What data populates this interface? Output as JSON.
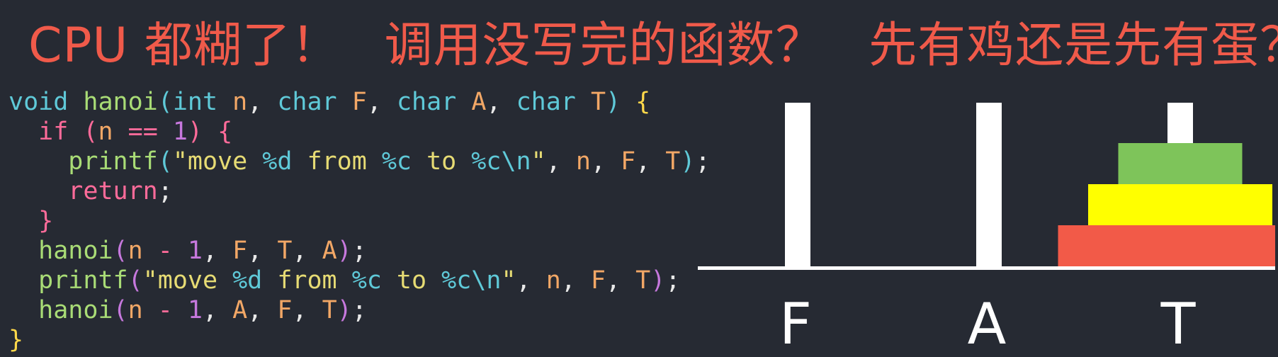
{
  "title": {
    "part1": "CPU 都糊了！",
    "part2": "调用没写完的函数？",
    "part3": "先有鸡还是先有蛋？"
  },
  "code_lines": [
    [
      {
        "t": "void",
        "c": "t-kw"
      },
      {
        "t": " ",
        "c": "t-punc"
      },
      {
        "t": "hanoi",
        "c": "t-fn"
      },
      {
        "t": "(",
        "c": "t-kw"
      },
      {
        "t": "int",
        "c": "t-kw"
      },
      {
        "t": " ",
        "c": "t-punc"
      },
      {
        "t": "n",
        "c": "t-var"
      },
      {
        "t": ", ",
        "c": "t-punc"
      },
      {
        "t": "char",
        "c": "t-kw"
      },
      {
        "t": " ",
        "c": "t-punc"
      },
      {
        "t": "F",
        "c": "t-var"
      },
      {
        "t": ", ",
        "c": "t-punc"
      },
      {
        "t": "char",
        "c": "t-kw"
      },
      {
        "t": " ",
        "c": "t-punc"
      },
      {
        "t": "A",
        "c": "t-var"
      },
      {
        "t": ", ",
        "c": "t-punc"
      },
      {
        "t": "char",
        "c": "t-kw"
      },
      {
        "t": " ",
        "c": "t-punc"
      },
      {
        "t": "T",
        "c": "t-var"
      },
      {
        "t": ")",
        "c": "t-kw"
      },
      {
        "t": " ",
        "c": "t-punc"
      },
      {
        "t": "{",
        "c": "t-brace"
      }
    ],
    [
      {
        "t": "  ",
        "c": "t-punc"
      },
      {
        "t": "if",
        "c": "t-ctrl"
      },
      {
        "t": " ",
        "c": "t-punc"
      },
      {
        "t": "(",
        "c": "t-ctrl"
      },
      {
        "t": "n",
        "c": "t-var"
      },
      {
        "t": " == ",
        "c": "t-op"
      },
      {
        "t": "1",
        "c": "t-num"
      },
      {
        "t": ")",
        "c": "t-ctrl"
      },
      {
        "t": " ",
        "c": "t-punc"
      },
      {
        "t": "{",
        "c": "t-ctrl"
      }
    ],
    [
      {
        "t": "    ",
        "c": "t-punc"
      },
      {
        "t": "printf",
        "c": "t-fn"
      },
      {
        "t": "(",
        "c": "t-kw"
      },
      {
        "t": "\"move ",
        "c": "t-str"
      },
      {
        "t": "%d",
        "c": "t-fmt"
      },
      {
        "t": " from ",
        "c": "t-str"
      },
      {
        "t": "%c",
        "c": "t-fmt"
      },
      {
        "t": " to ",
        "c": "t-str"
      },
      {
        "t": "%c\\n",
        "c": "t-fmt"
      },
      {
        "t": "\"",
        "c": "t-str"
      },
      {
        "t": ", ",
        "c": "t-punc"
      },
      {
        "t": "n",
        "c": "t-var"
      },
      {
        "t": ", ",
        "c": "t-punc"
      },
      {
        "t": "F",
        "c": "t-var"
      },
      {
        "t": ", ",
        "c": "t-punc"
      },
      {
        "t": "T",
        "c": "t-var"
      },
      {
        "t": ")",
        "c": "t-kw"
      },
      {
        "t": ";",
        "c": "t-punc"
      }
    ],
    [
      {
        "t": "    ",
        "c": "t-punc"
      },
      {
        "t": "return",
        "c": "t-ctrl"
      },
      {
        "t": ";",
        "c": "t-punc"
      }
    ],
    [
      {
        "t": "  ",
        "c": "t-punc"
      },
      {
        "t": "}",
        "c": "t-ctrl"
      }
    ],
    [
      {
        "t": "  ",
        "c": "t-punc"
      },
      {
        "t": "hanoi",
        "c": "t-fn"
      },
      {
        "t": "(",
        "c": "t-num"
      },
      {
        "t": "n",
        "c": "t-var"
      },
      {
        "t": " - ",
        "c": "t-op"
      },
      {
        "t": "1",
        "c": "t-num"
      },
      {
        "t": ", ",
        "c": "t-punc"
      },
      {
        "t": "F",
        "c": "t-var"
      },
      {
        "t": ", ",
        "c": "t-punc"
      },
      {
        "t": "T",
        "c": "t-var"
      },
      {
        "t": ", ",
        "c": "t-punc"
      },
      {
        "t": "A",
        "c": "t-var"
      },
      {
        "t": ")",
        "c": "t-num"
      },
      {
        "t": ";",
        "c": "t-punc"
      }
    ],
    [
      {
        "t": "  ",
        "c": "t-punc"
      },
      {
        "t": "printf",
        "c": "t-fn"
      },
      {
        "t": "(",
        "c": "t-num"
      },
      {
        "t": "\"move ",
        "c": "t-str"
      },
      {
        "t": "%d",
        "c": "t-fmt"
      },
      {
        "t": " from ",
        "c": "t-str"
      },
      {
        "t": "%c",
        "c": "t-fmt"
      },
      {
        "t": " to ",
        "c": "t-str"
      },
      {
        "t": "%c\\n",
        "c": "t-fmt"
      },
      {
        "t": "\"",
        "c": "t-str"
      },
      {
        "t": ", ",
        "c": "t-punc"
      },
      {
        "t": "n",
        "c": "t-var"
      },
      {
        "t": ", ",
        "c": "t-punc"
      },
      {
        "t": "F",
        "c": "t-var"
      },
      {
        "t": ", ",
        "c": "t-punc"
      },
      {
        "t": "T",
        "c": "t-var"
      },
      {
        "t": ")",
        "c": "t-num"
      },
      {
        "t": ";",
        "c": "t-punc"
      }
    ],
    [
      {
        "t": "  ",
        "c": "t-punc"
      },
      {
        "t": "hanoi",
        "c": "t-fn"
      },
      {
        "t": "(",
        "c": "t-num"
      },
      {
        "t": "n",
        "c": "t-var"
      },
      {
        "t": " - ",
        "c": "t-op"
      },
      {
        "t": "1",
        "c": "t-num"
      },
      {
        "t": ", ",
        "c": "t-punc"
      },
      {
        "t": "A",
        "c": "t-var"
      },
      {
        "t": ", ",
        "c": "t-punc"
      },
      {
        "t": "F",
        "c": "t-var"
      },
      {
        "t": ", ",
        "c": "t-punc"
      },
      {
        "t": "T",
        "c": "t-var"
      },
      {
        "t": ")",
        "c": "t-num"
      },
      {
        "t": ";",
        "c": "t-punc"
      }
    ],
    [
      {
        "t": "}",
        "c": "t-brace"
      }
    ]
  ],
  "pegs": [
    {
      "label": "F",
      "disk_count": 0
    },
    {
      "label": "A",
      "disk_count": 0
    },
    {
      "label": "T",
      "disk_count": 3
    }
  ],
  "disks_on_T": [
    {
      "name": "large",
      "size": 3,
      "color": "#f25a48"
    },
    {
      "name": "medium",
      "size": 2,
      "color": "#ffff00"
    },
    {
      "name": "small",
      "size": 1,
      "color": "#7ec45a"
    }
  ],
  "colors": {
    "title": "#f05a4a",
    "background": "#262a33",
    "peg": "#ffffff"
  }
}
